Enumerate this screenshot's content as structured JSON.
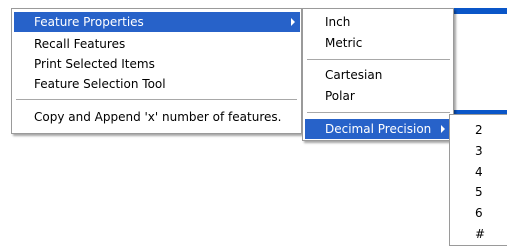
{
  "main_menu": {
    "items": [
      {
        "label": "Feature Properties",
        "highlighted": true,
        "has_submenu": true
      },
      {
        "label": "Recall Features"
      },
      {
        "label": "Print Selected Items"
      },
      {
        "label": "Feature Selection Tool"
      },
      {
        "label": "Copy and Append 'x' number of features."
      }
    ]
  },
  "units_menu": {
    "items": [
      {
        "label": "Inch"
      },
      {
        "label": "Metric"
      },
      {
        "label": "Cartesian"
      },
      {
        "label": "Polar"
      },
      {
        "label": "Decimal Precision",
        "highlighted": true,
        "has_submenu": true
      }
    ]
  },
  "precision_menu": {
    "items": [
      "2",
      "3",
      "4",
      "5",
      "6",
      "#"
    ]
  },
  "colors": {
    "highlight": "#2762c9",
    "background_bar": "#0a56c8",
    "menu_border": "#9a9a9a",
    "separator": "#a8a8a8"
  },
  "icons": [
    "submenu-arrow-icon"
  ]
}
